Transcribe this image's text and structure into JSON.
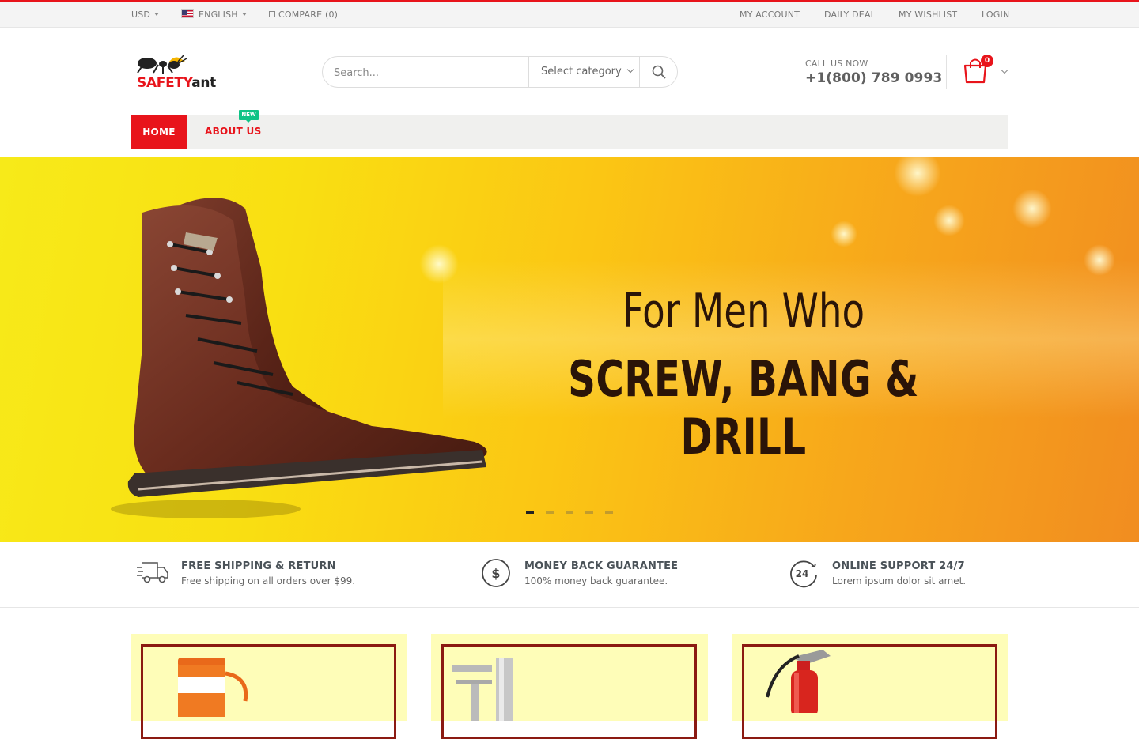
{
  "topbar": {
    "currency": "USD",
    "language": "ENGLISH",
    "compare": "COMPARE (0)",
    "links": [
      "MY ACCOUNT",
      "DAILY DEAL",
      "MY WISHLIST",
      "LOGIN"
    ]
  },
  "brand": {
    "part1": "SAFETY",
    "part2": "ant",
    "accent": "#e8141b"
  },
  "search": {
    "placeholder": "Search...",
    "category": "Select category"
  },
  "contact": {
    "label": "CALL US NOW",
    "phone": "+1(800) 789 0993"
  },
  "cart": {
    "count": "0"
  },
  "nav": {
    "home": "HOME",
    "about": "ABOUT US",
    "new_badge": "NEW"
  },
  "hero": {
    "line1": "For Men Who",
    "line2": "SCREW, BANG & DRILL",
    "slide_count": 5,
    "active_slide": 1
  },
  "features": [
    {
      "icon": "truck-icon",
      "title": "FREE SHIPPING & RETURN",
      "subtitle": "Free shipping on all orders over $99."
    },
    {
      "icon": "dollar-icon",
      "title": "MONEY BACK GUARANTEE",
      "subtitle": "100% money back guarantee."
    },
    {
      "icon": "support-24-icon",
      "title": "ONLINE SUPPORT  24/7",
      "subtitle": "Lorem ipsum dolor sit amet."
    }
  ],
  "promo_cards": [
    {
      "product": "wipes-bucket"
    },
    {
      "product": "eyewash-faucet"
    },
    {
      "product": "fire-extinguisher"
    }
  ]
}
